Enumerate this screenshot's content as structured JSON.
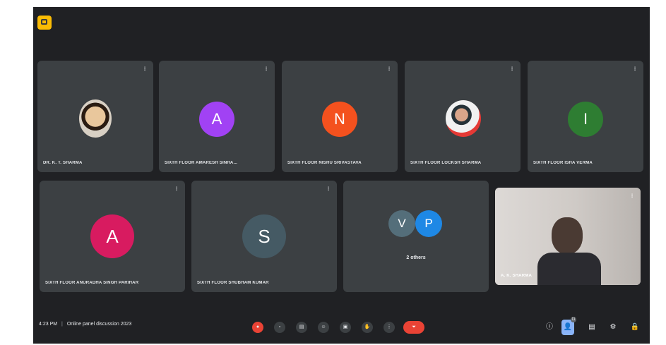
{
  "app": {
    "brand_color": "#fbbc04"
  },
  "tiles_row1": [
    {
      "name": "DR. K. T. SHARMA",
      "kind": "photo",
      "mic": "⁞"
    },
    {
      "name": "SIXTH FLOOR AMARESH SINHA...",
      "kind": "initial",
      "initial": "A",
      "color": "#a142f4",
      "mic": "⁞"
    },
    {
      "name": "SIXTH FLOOR NISHU SRIVASTAVA",
      "kind": "initial",
      "initial": "N",
      "color": "#f4511e",
      "mic": "⁞"
    },
    {
      "name": "SIXTH FLOOR LOCKSH SHARMA",
      "kind": "photo",
      "mic": "⁞"
    },
    {
      "name": "SIXTH FLOOR ISHA VERMA",
      "kind": "initial",
      "initial": "I",
      "color": "#2e7d32",
      "mic": "⁞"
    }
  ],
  "tiles_row2": [
    {
      "name": "SIXTH FLOOR ANURADHA SINGH PARIHAR",
      "kind": "initial",
      "initial": "A",
      "color": "#d81b60",
      "mic": "⁞"
    },
    {
      "name": "SIXTH FLOOR SHUBHAM KUMAR",
      "kind": "initial",
      "initial": "S",
      "color": "#455a64",
      "mic": "⁞"
    },
    {
      "name": "2 others",
      "kind": "group",
      "initials": [
        "V",
        "P"
      ],
      "colors": [
        "#546e7a",
        "#1e88e5"
      ],
      "mic": ""
    },
    {
      "name": "A. K. SHARMA",
      "kind": "video",
      "mic": "⁞"
    }
  ],
  "bottom_bar": {
    "time": "4:23 PM",
    "separator": "|",
    "meeting_title": "Online panel discussion 2023",
    "controls": [
      "mic-off",
      "camera",
      "captions",
      "emoji",
      "present",
      "raise-hand",
      "more"
    ],
    "end_call_label": "⏷",
    "right_icons": [
      "info",
      "people",
      "chat",
      "activities",
      "host-controls"
    ],
    "people_count": "11"
  }
}
